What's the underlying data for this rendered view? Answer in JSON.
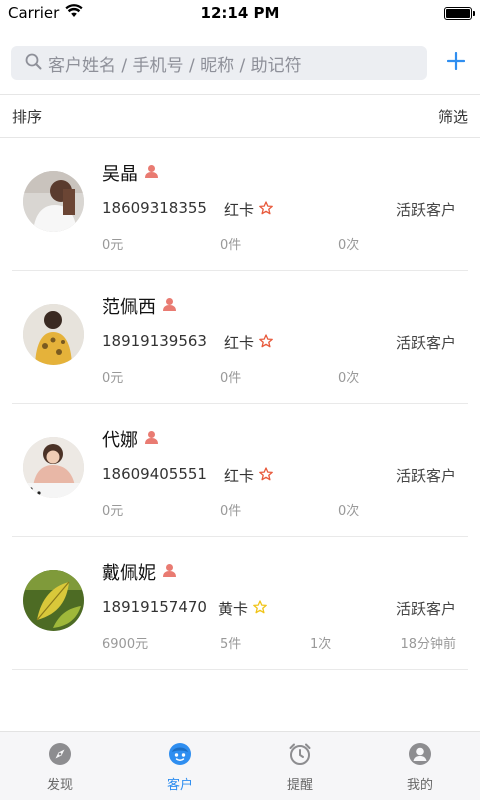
{
  "status_bar": {
    "carrier": "Carrier",
    "time": "12:14 PM"
  },
  "search": {
    "placeholder": "客户姓名 / 手机号 / 昵称 / 助记符"
  },
  "sort_bar": {
    "sort_label": "排序",
    "filter_label": "筛选"
  },
  "colors": {
    "accent": "#2f8ef0",
    "person_icon": "#e97b72",
    "red_card_star": "#e8593b",
    "yellow_card_star": "#f0c419",
    "muted": "#999999"
  },
  "customers": [
    {
      "name": "吴晶",
      "phone": "18609318355",
      "card": "红卡",
      "card_star": "outline-star-red-icon",
      "status": "活跃客户",
      "amount": "0元",
      "items": "0件",
      "visits": "0次",
      "last_visit": ""
    },
    {
      "name": "范佩西",
      "phone": "18919139563",
      "card": "红卡",
      "card_star": "outline-star-red-icon",
      "status": "活跃客户",
      "amount": "0元",
      "items": "0件",
      "visits": "0次",
      "last_visit": ""
    },
    {
      "name": "代娜",
      "phone": "18609405551",
      "card": "红卡",
      "card_star": "outline-star-red-icon",
      "status": "活跃客户",
      "amount": "0元",
      "items": "0件",
      "visits": "0次",
      "last_visit": ""
    },
    {
      "name": "戴佩妮",
      "phone": "18919157470",
      "card": "黄卡",
      "card_star": "outline-star-yellow-icon",
      "status": "活跃客户",
      "amount": "6900元",
      "items": "5件",
      "visits": "1次",
      "last_visit": "18分钟前"
    }
  ],
  "tabs": [
    {
      "label": "发现",
      "icon": "compass-icon",
      "active": false
    },
    {
      "label": "客户",
      "icon": "face-icon",
      "active": true
    },
    {
      "label": "提醒",
      "icon": "alarm-clock-icon",
      "active": false
    },
    {
      "label": "我的",
      "icon": "user-circle-icon",
      "active": false
    }
  ]
}
